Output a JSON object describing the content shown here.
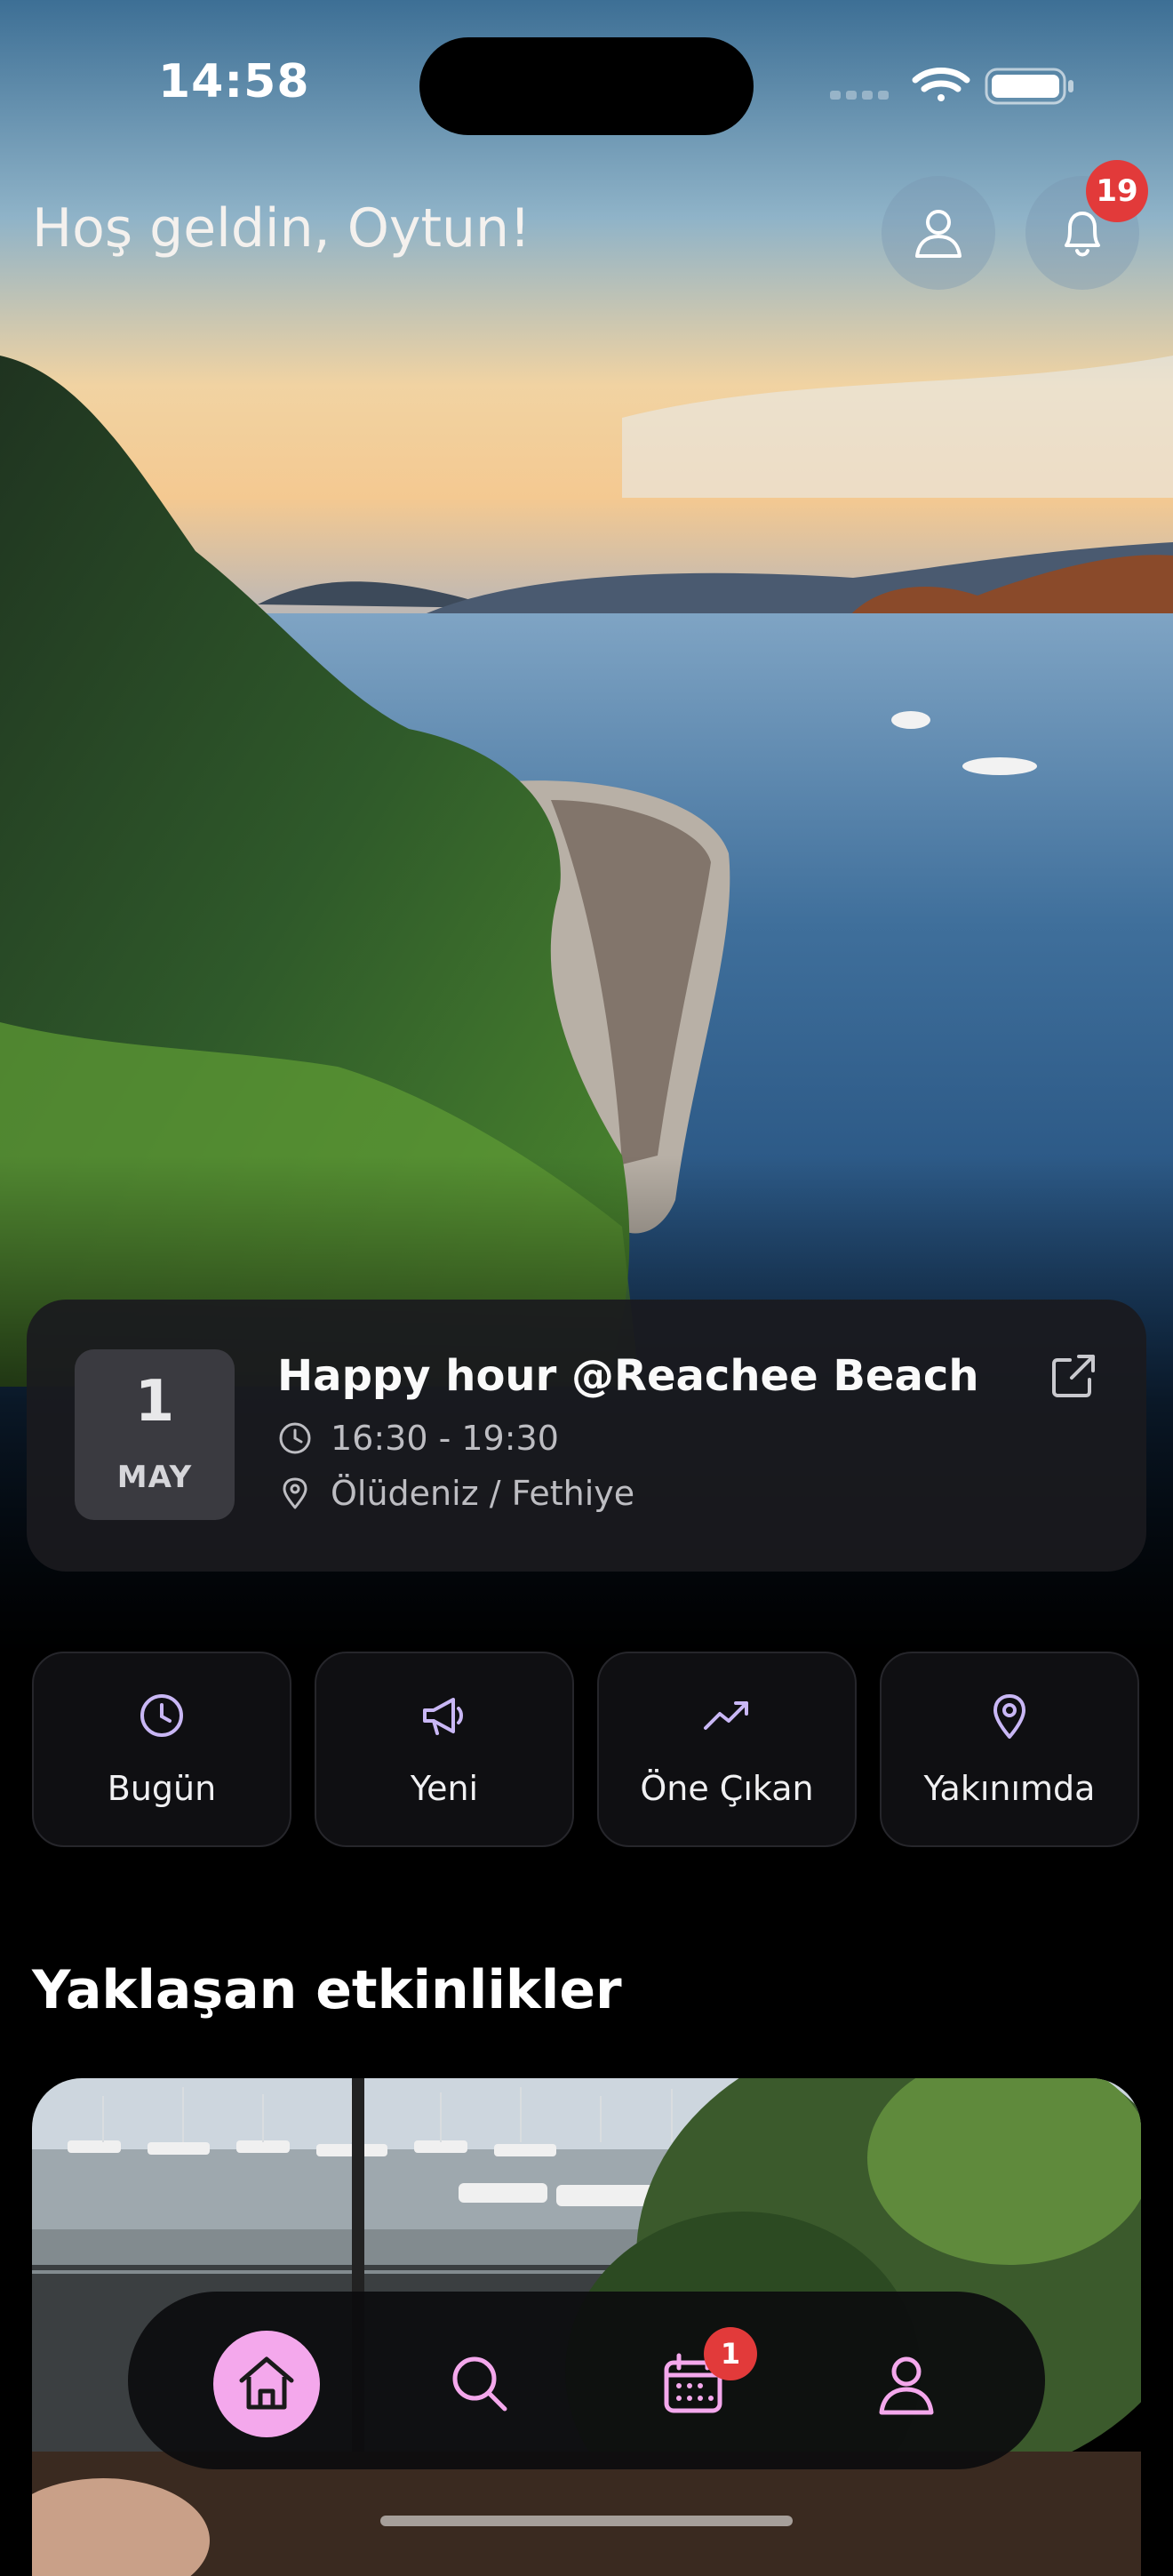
{
  "status_bar": {
    "time": "14:58"
  },
  "header": {
    "greeting": "Hoş geldin, Oytun!",
    "notification_count": "19"
  },
  "featured_event": {
    "day": "1",
    "month": "MAY",
    "title": "Happy hour @Reachee Beach",
    "time": "16:30 - 19:30",
    "location": "Ölüdeniz / Fethiye"
  },
  "filters": [
    {
      "label": "Bugün",
      "icon": "clock-icon"
    },
    {
      "label": "Yeni",
      "icon": "megaphone-icon"
    },
    {
      "label": "Öne Çıkan",
      "icon": "trending-up-icon"
    },
    {
      "label": "Yakınımda",
      "icon": "map-pin-icon"
    }
  ],
  "upcoming": {
    "title": "Yaklaşan etkinlikler"
  },
  "bottom_nav": {
    "items": [
      "home-icon",
      "search-icon",
      "calendar-icon",
      "user-icon"
    ],
    "calendar_badge": "1",
    "active": "home-icon"
  },
  "colors": {
    "accent": "#f4a8ec",
    "badge": "#e23a3a",
    "card": "#1a1a1e"
  }
}
